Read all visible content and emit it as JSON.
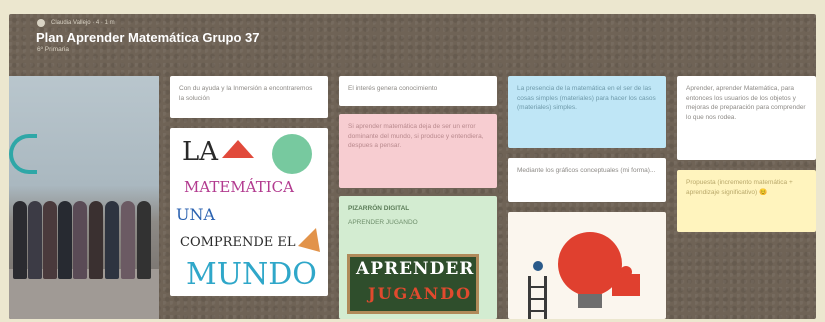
{
  "board": {
    "meta": "Claudia Vallejo · 4 · 1 m",
    "title": "Plan Aprender Matemática Grupo 37",
    "subtitle": "6º Primaria"
  },
  "cards": {
    "c1": "Con du ayuda y la Inmersión a encontraremos la solución",
    "c2": "El interés genera conocimiento",
    "c3": "Si aprender matemática deja de ser un error dominante del mundo, si produce y entendiera, despues a pensar.",
    "c4_title": "PIZARRÓN DIGITAL",
    "c4_sub": "APRENDER JUGANDO",
    "c5": "La presencia de la matemática en el ser de las cosas simples (materiales) para hacer los casos (materiales) simples.",
    "c6": "Mediante los gráficos conceptuales (mi forma)...",
    "c7": "Aprender, aprender Matemática, para entonces los usuarios de los objetos y mejoras de preparación para comprender lo que nos rodea.",
    "c8": "Propuesta (incremento matemática + aprendizaje significativo) 😊"
  },
  "collage": {
    "line1": "LA",
    "line2": "MATEMÁTICA",
    "line3": "UNA",
    "line4": "COMPRENDE EL",
    "line5": "MUNDO"
  },
  "sign": {
    "top": "APRENDER",
    "bottom": "JUGANDO"
  },
  "colors": {
    "board_bg": "#6f6356",
    "pink": "#f7cdd1",
    "blue": "#bfe6f6",
    "yellow": "#fff4be",
    "green": "#d3ecd1"
  }
}
